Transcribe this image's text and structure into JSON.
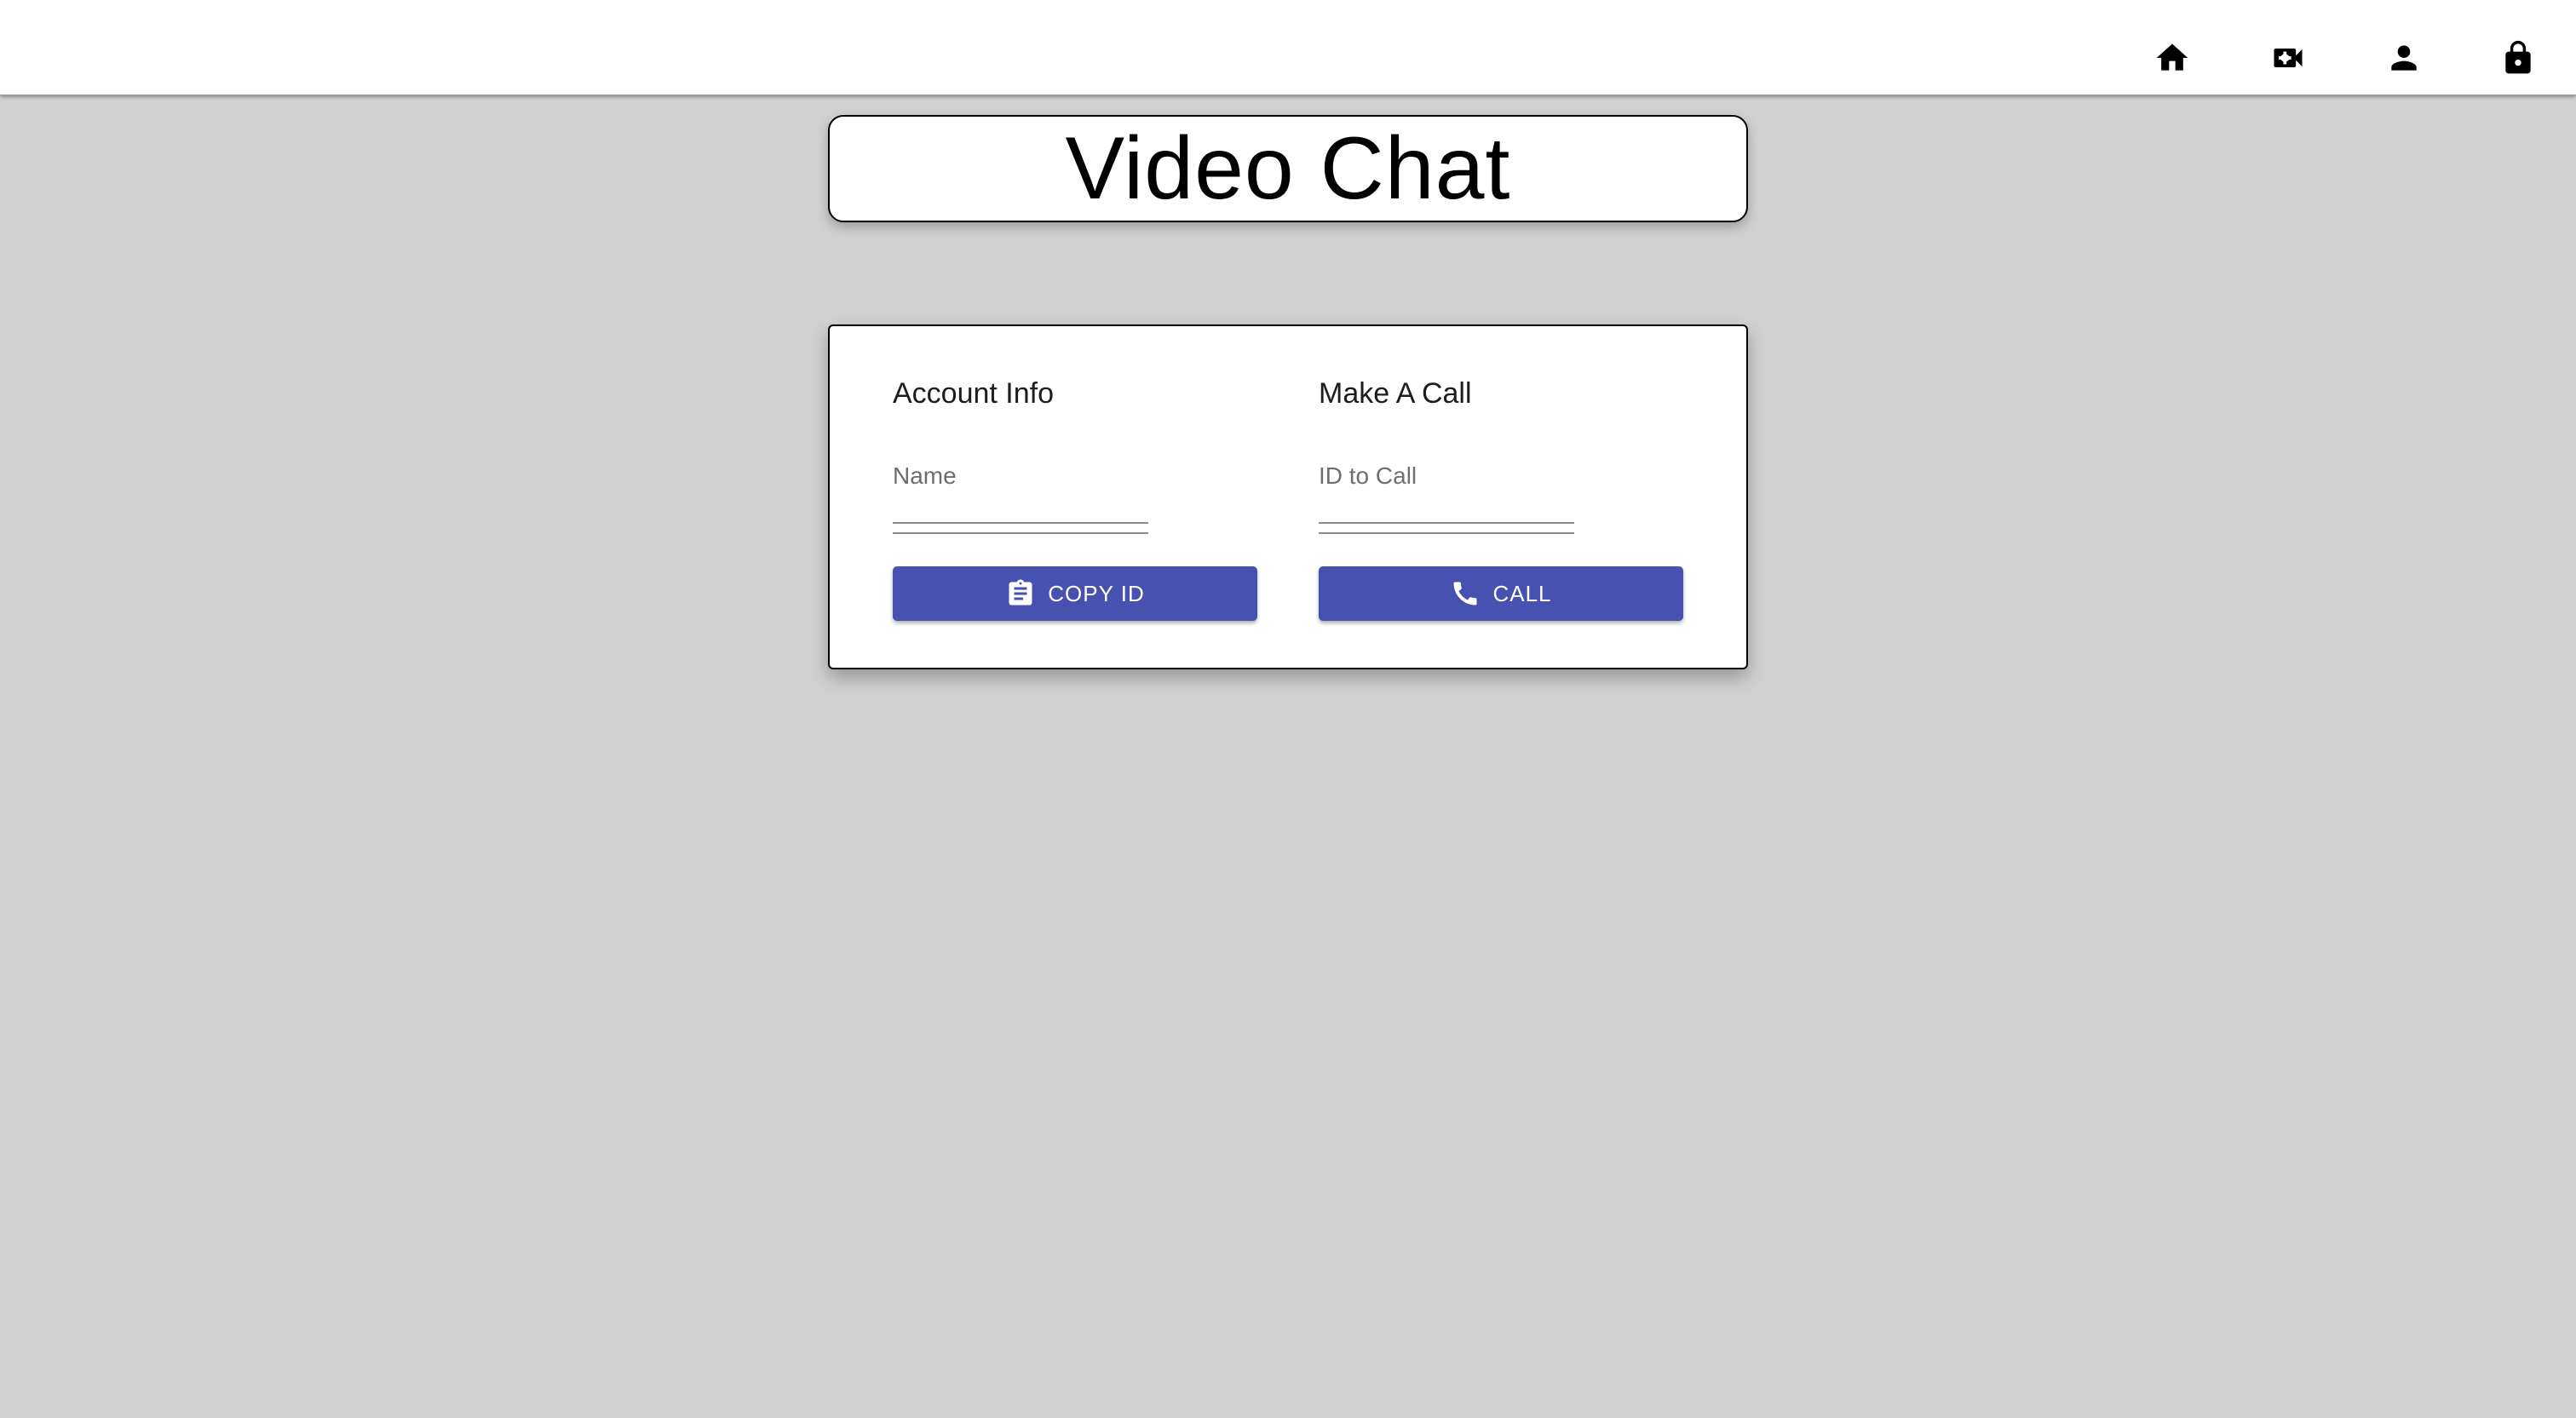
{
  "nav": {
    "items": [
      {
        "name": "home",
        "icon": "home-icon"
      },
      {
        "name": "video",
        "icon": "video-icon"
      },
      {
        "name": "account",
        "icon": "person-icon"
      },
      {
        "name": "logout",
        "icon": "lock-icon"
      }
    ]
  },
  "header": {
    "title": "Video Chat"
  },
  "account": {
    "heading": "Account Info",
    "name_label": "Name",
    "name_value": "",
    "copy_button_label": "COPY ID",
    "copy_button_icon": "clipboard-icon"
  },
  "call": {
    "heading": "Make A Call",
    "id_label": "ID to Call",
    "id_value": "",
    "call_button_label": "CALL",
    "call_button_icon": "phone-icon"
  },
  "colors": {
    "background": "#d2d1d1",
    "button": "#4651b0",
    "card": "#ffffff"
  }
}
